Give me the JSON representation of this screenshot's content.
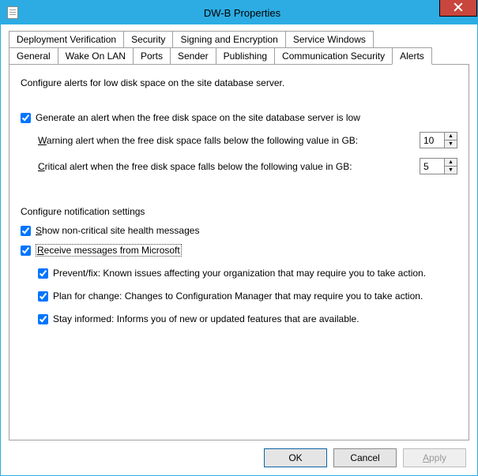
{
  "window": {
    "title": "DW-B Properties"
  },
  "tabs": {
    "row1": [
      {
        "label": "Deployment Verification"
      },
      {
        "label": "Security"
      },
      {
        "label": "Signing and Encryption"
      },
      {
        "label": "Service Windows"
      }
    ],
    "row2": [
      {
        "label": "General"
      },
      {
        "label": "Wake On LAN"
      },
      {
        "label": "Ports"
      },
      {
        "label": "Sender"
      },
      {
        "label": "Publishing"
      },
      {
        "label": "Communication Security"
      },
      {
        "label": "Alerts",
        "active": true
      }
    ]
  },
  "content": {
    "description": "Configure alerts for low disk space on the site database server.",
    "generate_alert": {
      "checked": true,
      "label": "Generate an alert when the free disk space on the site database server is low"
    },
    "warning": {
      "label": "Warning alert when the free disk space falls below the following value in GB:",
      "value": "10"
    },
    "critical": {
      "label": "Critical alert when the free disk space falls below the following value in GB:",
      "value": "5"
    },
    "notification": {
      "header": "Configure notification settings",
      "show_noncritical": {
        "checked": true,
        "label": "Show non-critical site health messages"
      },
      "receive_ms": {
        "checked": true,
        "label": "Receive messages from Microsoft"
      },
      "prevent_fix": {
        "checked": true,
        "label": "Prevent/fix: Known issues affecting your organization that may require you to take action."
      },
      "plan_change": {
        "checked": true,
        "label": "Plan for change: Changes to Configuration Manager that may require you to take action."
      },
      "stay_informed": {
        "checked": true,
        "label": "Stay informed: Informs you of new or updated features that are available."
      }
    }
  },
  "buttons": {
    "ok": "OK",
    "cancel": "Cancel",
    "apply": "Apply"
  }
}
